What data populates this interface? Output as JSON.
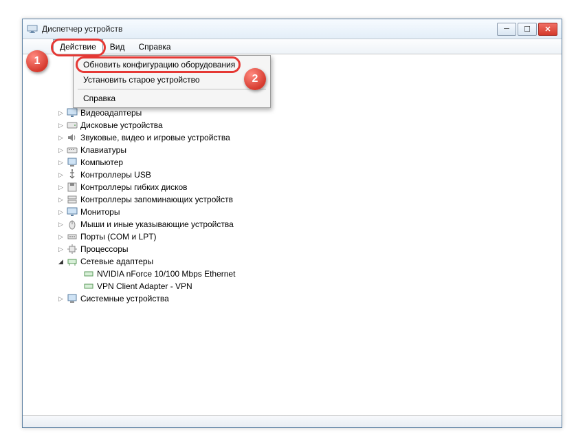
{
  "window": {
    "title": "Диспетчер устройств"
  },
  "menubar": {
    "action": "Действие",
    "view": "Вид",
    "help": "Справка"
  },
  "dropdown": {
    "refresh": "Обновить конфигурацию оборудования",
    "legacy": "Установить старое устройство",
    "help": "Справка"
  },
  "badges": {
    "one": "1",
    "two": "2"
  },
  "tree": {
    "video": "Видеоадаптеры",
    "disk": "Дисковые устройства",
    "sound": "Звуковые, видео и игровые устройства",
    "keyboards": "Клавиатуры",
    "computer": "Компьютер",
    "usb": "Контроллеры USB",
    "floppy": "Контроллеры гибких дисков",
    "storage": "Контроллеры запоминающих устройств",
    "monitors": "Мониторы",
    "mice": "Мыши и иные указывающие устройства",
    "ports": "Порты (COM и LPT)",
    "cpu": "Процессоры",
    "network": "Сетевые адаптеры",
    "net1": "NVIDIA nForce 10/100 Mbps Ethernet",
    "net2": "VPN Client Adapter - VPN",
    "system": "Системные устройства"
  },
  "icons": {
    "expand": "▷",
    "collapse": "◢"
  }
}
